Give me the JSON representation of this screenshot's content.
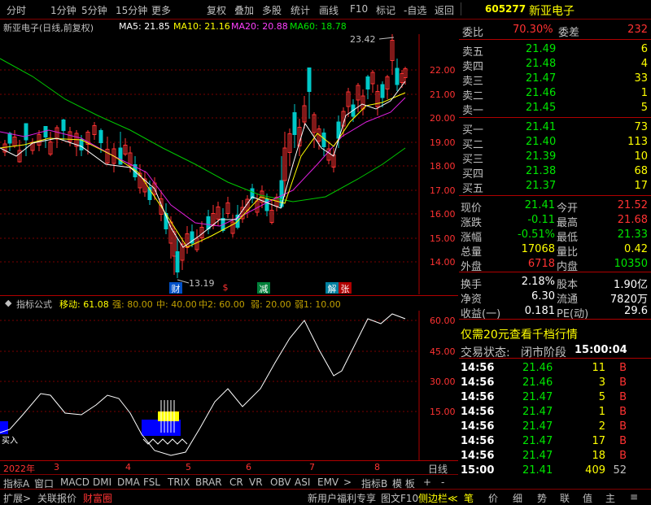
{
  "toolbar": {
    "items": [
      "分时",
      "1分钟",
      "5分钟",
      "15分钟",
      "更多",
      "复权",
      "叠加",
      "多股",
      "统计",
      "画线",
      "F10",
      "标记",
      "-自选",
      "返回"
    ]
  },
  "stock": {
    "code": "605277",
    "name": "新亚电子"
  },
  "ma": {
    "title": "新亚电子(日线,前复权)",
    "ma5": "MA5: 21.85",
    "ma10": "MA10: 21.16",
    "ma20": "MA20: 20.88",
    "ma60": "MA60: 18.78"
  },
  "price_axis": [
    "22.00",
    "21.00",
    "20.00",
    "19.00",
    "18.00",
    "17.00",
    "16.00",
    "15.00",
    "14.00"
  ],
  "markers": {
    "high": "23.42",
    "low": "13.19",
    "events": [
      "财",
      "$",
      "减",
      "解",
      "张"
    ]
  },
  "indicator": {
    "name": "指标公式",
    "ydl": "移动: 61.08",
    "qiang": "强: 80.00",
    "zhong": "中: 40.00",
    "zhong2": "中2: 60.00",
    "ruo": "弱: 20.00",
    "ruo1": "弱1: 10.00",
    "axis": [
      "60.00",
      "45.00",
      "30.00",
      "15.00"
    ],
    "label": "买入"
  },
  "dates": {
    "year": "2022年",
    "months": [
      "3",
      "4",
      "5",
      "6",
      "7",
      "8"
    ],
    "period": "日线"
  },
  "tabs": [
    "指标A",
    "窗口",
    "MACD",
    "DMI",
    "DMA",
    "FSL",
    "TRIX",
    "BRAR",
    "CR",
    "VR",
    "OBV",
    "ASI",
    "EMV",
    ">",
    "指标B",
    "模 板",
    "+",
    "-"
  ],
  "footer": [
    "扩展>",
    "关联报价",
    "财富圈",
    "新用户福利专享",
    "图文F10",
    "侧边栏≪",
    "笔",
    "价",
    "细",
    "势",
    "联",
    "值",
    "主",
    "≡"
  ],
  "quote": {
    "weibi_label": "委比",
    "weibi": "70.30%",
    "weicha_label": "委差",
    "weicha": "232",
    "asks": [
      {
        "l": "卖五",
        "p": "21.49",
        "v": "6"
      },
      {
        "l": "卖四",
        "p": "21.48",
        "v": "4"
      },
      {
        "l": "卖三",
        "p": "21.47",
        "v": "33"
      },
      {
        "l": "卖二",
        "p": "21.46",
        "v": "1"
      },
      {
        "l": "卖一",
        "p": "21.45",
        "v": "5"
      }
    ],
    "bids": [
      {
        "l": "买一",
        "p": "21.41",
        "v": "73"
      },
      {
        "l": "买二",
        "p": "21.40",
        "v": "113"
      },
      {
        "l": "买三",
        "p": "21.39",
        "v": "10"
      },
      {
        "l": "买四",
        "p": "21.38",
        "v": "68"
      },
      {
        "l": "买五",
        "p": "21.37",
        "v": "17"
      }
    ],
    "stats": [
      {
        "a": "现价",
        "av": "21.41",
        "b": "今开",
        "bv": "21.52"
      },
      {
        "a": "涨跌",
        "av": "-0.11",
        "b": "最高",
        "bv": "21.68"
      },
      {
        "a": "涨幅",
        "av": "-0.51%",
        "b": "最低",
        "bv": "21.33"
      },
      {
        "a": "总量",
        "av": "17068",
        "b": "量比",
        "bv": "0.42"
      },
      {
        "a": "外盘",
        "av": "6718",
        "b": "内盘",
        "bv": "10350"
      },
      {
        "a": "换手",
        "av": "2.18%",
        "b": "股本",
        "bv": "1.90亿"
      },
      {
        "a": "净资",
        "av": "6.30",
        "b": "流通",
        "bv": "7820万"
      },
      {
        "a": "收益(一)",
        "av": "0.181",
        "b": "PE(动)",
        "bv": "29.6"
      }
    ],
    "promo": "仅需20元查看千档行情",
    "status_label": "交易状态:",
    "status": "闭市阶段",
    "status_time": "15:00:04",
    "ticks": [
      {
        "t": "14:56",
        "p": "21.46",
        "v": "11",
        "d": "B"
      },
      {
        "t": "14:56",
        "p": "21.46",
        "v": "3",
        "d": "B"
      },
      {
        "t": "14:56",
        "p": "21.47",
        "v": "5",
        "d": "B"
      },
      {
        "t": "14:56",
        "p": "21.47",
        "v": "1",
        "d": "B"
      },
      {
        "t": "14:56",
        "p": "21.47",
        "v": "2",
        "d": "B"
      },
      {
        "t": "14:56",
        "p": "21.47",
        "v": "17",
        "d": "B"
      },
      {
        "t": "14:56",
        "p": "21.47",
        "v": "18",
        "d": "B"
      },
      {
        "t": "15:00",
        "p": "21.41",
        "v": "409",
        "d": "52"
      }
    ]
  }
}
